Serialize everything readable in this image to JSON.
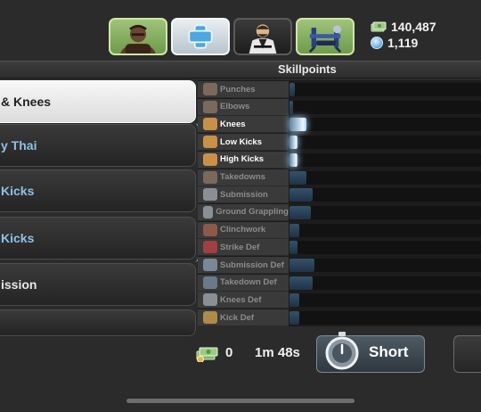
{
  "currency": {
    "money": "140,487",
    "coins": "1,119"
  },
  "header": {
    "skillpoints_label": "Skillpoints"
  },
  "categories": [
    {
      "label": "& Knees",
      "state": "selected"
    },
    {
      "label": "y Thai",
      "state": "normal"
    },
    {
      "label": "Kicks",
      "state": "normal"
    },
    {
      "label": "Kicks",
      "state": "normal"
    },
    {
      "label": "ission",
      "state": "dim"
    }
  ],
  "skills": [
    {
      "label": "Punches",
      "level": 0.03,
      "active": false
    },
    {
      "label": "Elbows",
      "level": 0.02,
      "active": false
    },
    {
      "label": "Knees",
      "level": 0.09,
      "active": true
    },
    {
      "label": "Low Kicks",
      "level": 0.04,
      "active": true
    },
    {
      "label": "High Kicks",
      "level": 0.04,
      "active": true
    },
    {
      "label": "Takedowns",
      "level": 0.09,
      "active": false
    },
    {
      "label": "Submission",
      "level": 0.12,
      "active": false
    },
    {
      "label": "Ground Grappling",
      "level": 0.11,
      "active": false
    },
    {
      "label": "Clinchwork",
      "level": 0.05,
      "active": false
    },
    {
      "label": "Strike Def",
      "level": 0.04,
      "active": false
    },
    {
      "label": "Submission Def",
      "level": 0.13,
      "active": false
    },
    {
      "label": "Takedown Def",
      "level": 0.12,
      "active": false
    },
    {
      "label": "Knees Def",
      "level": 0.05,
      "active": false
    },
    {
      "label": "Kick Def",
      "level": 0.05,
      "active": false
    }
  ],
  "bottom": {
    "cost": "0",
    "duration": "1m 48s",
    "short_label": "Short"
  },
  "icons": {
    "nav": [
      "fighter-portrait-icon",
      "medical-cross-icon",
      "coach-portrait-icon",
      "gym-equipment-icon"
    ],
    "currency": [
      "money-icon",
      "coin-icon"
    ]
  },
  "colors": {
    "accent_blue": "#8fc1e3",
    "bar_fill": "#2a4257",
    "bar_active": "#e9f6ff"
  }
}
